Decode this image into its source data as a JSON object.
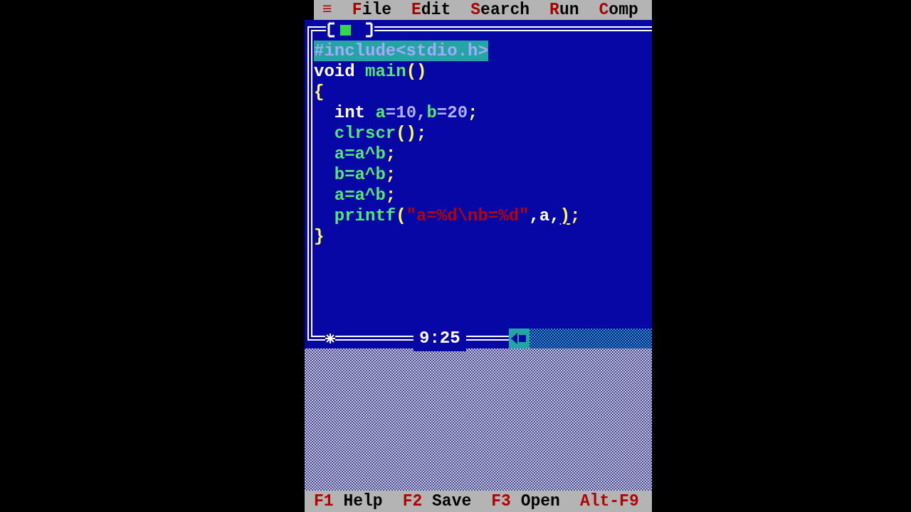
{
  "menu": {
    "items": [
      {
        "label": "≡",
        "kind": "system"
      },
      {
        "label": "File",
        "kind": "menu"
      },
      {
        "label": "Edit",
        "kind": "menu"
      },
      {
        "label": "Search",
        "kind": "menu"
      },
      {
        "label": "Run",
        "kind": "menu"
      },
      {
        "label": "Comp",
        "kind": "menu"
      }
    ]
  },
  "editor": {
    "modified": true,
    "position": "9:25",
    "lines": [
      {
        "selected": true,
        "segments": [
          {
            "text": "#include<stdio.h>",
            "kind": "directive"
          }
        ]
      },
      {
        "selected": false,
        "segments": [
          {
            "text": "void ",
            "kind": "keyword"
          },
          {
            "text": "main",
            "kind": "ident"
          },
          {
            "text": "()",
            "kind": "punct"
          }
        ]
      },
      {
        "selected": false,
        "segments": [
          {
            "text": "{",
            "kind": "punct"
          }
        ]
      },
      {
        "selected": false,
        "segments": [
          {
            "text": "  int ",
            "kind": "keyword"
          },
          {
            "text": "a",
            "kind": "ident"
          },
          {
            "text": "=10,",
            "kind": "number"
          },
          {
            "text": "b",
            "kind": "ident"
          },
          {
            "text": "=20",
            "kind": "number"
          },
          {
            "text": ";",
            "kind": "punct"
          }
        ]
      },
      {
        "selected": false,
        "segments": [
          {
            "text": "  clrscr",
            "kind": "ident"
          },
          {
            "text": "();",
            "kind": "punct"
          }
        ]
      },
      {
        "selected": false,
        "segments": [
          {
            "text": "  a=a^b",
            "kind": "ident"
          },
          {
            "text": ";",
            "kind": "punct"
          }
        ]
      },
      {
        "selected": false,
        "segments": [
          {
            "text": "  b=a^b",
            "kind": "ident"
          },
          {
            "text": ";",
            "kind": "punct"
          }
        ]
      },
      {
        "selected": false,
        "segments": [
          {
            "text": "  a=a^b",
            "kind": "ident"
          },
          {
            "text": ";",
            "kind": "punct"
          }
        ]
      },
      {
        "selected": false,
        "segments": [
          {
            "text": "  printf",
            "kind": "ident"
          },
          {
            "text": "(",
            "kind": "punct"
          },
          {
            "text": "\"a=%d\\nb=%d\"",
            "kind": "string"
          },
          {
            "text": ",a,",
            "kind": "keyword"
          },
          {
            "text": ")",
            "kind": "cursor"
          },
          {
            "text": ";",
            "kind": "punct"
          }
        ]
      },
      {
        "selected": false,
        "segments": [
          {
            "text": "}",
            "kind": "punct"
          }
        ]
      }
    ]
  },
  "status_bar": {
    "items": [
      {
        "key": "F1",
        "label": "Help"
      },
      {
        "key": "F2",
        "label": "Save"
      },
      {
        "key": "F3",
        "label": "Open"
      },
      {
        "key": "Alt-F9"
      }
    ]
  }
}
